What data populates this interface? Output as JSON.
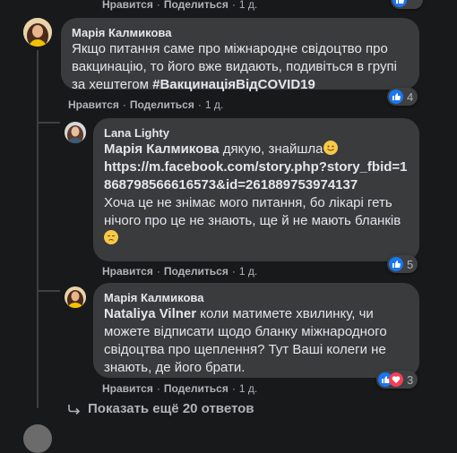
{
  "actions": {
    "like": "Нравится",
    "reply": "Поделиться",
    "dot": "·",
    "time": "1 д."
  },
  "comments": [
    {
      "author": "Марія Калмикова",
      "text": "Якщо питання саме про міжнародне свідоцтво про вакцинацію, то його вже видають, подивіться в групі за хештегом ",
      "hashtag": "#ВакцинаціяВідCOVID19",
      "reaction_count": "4"
    },
    {
      "author": "Lana Lighty",
      "mention": "Марія Калмикова",
      "text_after_mention": " дякую, знайшла",
      "link": "https://m.facebook.com/story.php?story_fbid=1868798566616573&id=261889753974137",
      "text2": "Хоча це не знімає мого питання, бо лікарі геть нічого про це не знають, ще й не мають бланків",
      "reaction_count": "5"
    },
    {
      "author": "Марія Калмикова",
      "mention": "Nataliya Vilner",
      "text": " коли матимете хвилинку, чи можете відписати щодо бланку міжнародного свідоцтва про щеплення? Тут Ваші колеги не знають, де його брати.",
      "reaction_count": "3"
    }
  ],
  "more_replies": "Показать ещё 20 ответов",
  "colors": {
    "background": "#18191a",
    "bubble": "#3a3b3c",
    "text": "#e4e6eb",
    "secondary": "#b0b3b8",
    "like": "#1877f2",
    "love": "#f33e58"
  }
}
